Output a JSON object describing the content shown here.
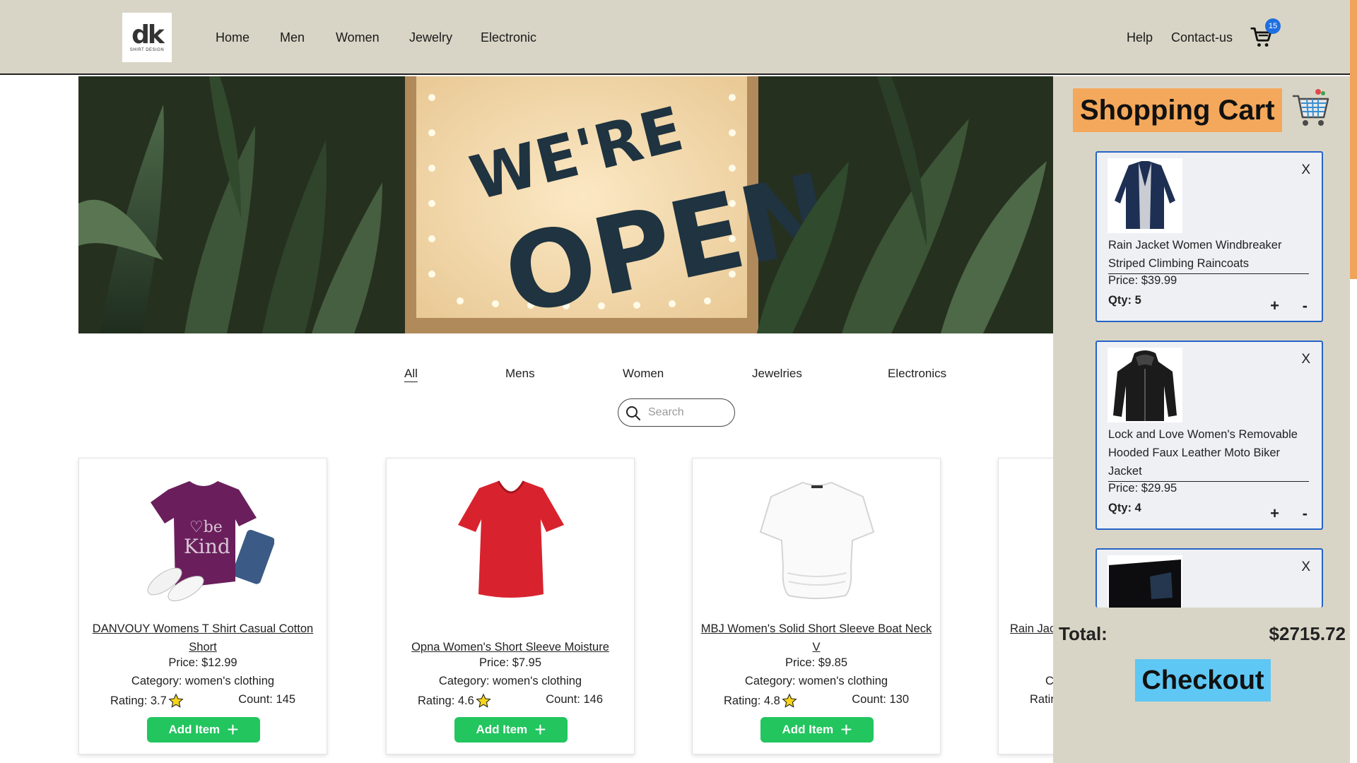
{
  "brand": {
    "logo_text": "dk",
    "logo_sub": "SHIRT DESIGN"
  },
  "nav": {
    "home": "Home",
    "men": "Men",
    "women": "Women",
    "jewelry": "Jewelry",
    "electronic": "Electronic",
    "help": "Help",
    "contact": "Contact-us",
    "cart_count": "15"
  },
  "hero": {
    "sign_line1": "WE'RE",
    "sign_line2": "OPEN"
  },
  "filters": {
    "all": "All",
    "mens": "Mens",
    "women": "Women",
    "jewelries": "Jewelries",
    "electronics": "Electronics"
  },
  "search": {
    "placeholder": "Search"
  },
  "products": [
    {
      "title": "DANVOUY Womens T Shirt Casual Cotton Short",
      "price": "Price: $12.99",
      "category": "Category: women's clothing",
      "rating": "Rating: 3.7",
      "count": "Count: 145",
      "button": "Add Item"
    },
    {
      "title": "Opna Women's Short Sleeve Moisture",
      "price": "Price: $7.95",
      "category": "Category: women's clothing",
      "rating": "Rating: 4.6",
      "count": "Count: 146",
      "button": "Add Item"
    },
    {
      "title": "MBJ Women's Solid Short Sleeve Boat Neck V",
      "price": "Price: $9.85",
      "category": "Category: women's clothing",
      "rating": "Rating: 4.8",
      "count": "Count: 130",
      "button": "Add Item"
    },
    {
      "title": "Rain Jac",
      "price": "",
      "category": "C",
      "rating": "Ratir",
      "count": "",
      "button": ""
    }
  ],
  "cart": {
    "heading": "Shopping Cart",
    "items": [
      {
        "title": "Rain Jacket Women Windbreaker Striped Climbing Raincoats",
        "price": "Price: $39.99",
        "qty": "Qty: 5",
        "close": "X",
        "plus": "+",
        "minus": "-"
      },
      {
        "title": "Lock and Love Women's Removable Hooded Faux Leather Moto Biker Jacket",
        "price": "Price: $29.95",
        "qty": "Qty: 4",
        "close": "X",
        "plus": "+",
        "minus": "-"
      },
      {
        "close": "X"
      }
    ],
    "total_label": "Total:",
    "total_value": "$2715.72",
    "checkout": "Checkout"
  },
  "colors": {
    "topbar": "#d9d5c6",
    "add_button": "#22c55e",
    "cart_heading": "#f4a85b",
    "checkout": "#5fc7f3",
    "cart_border": "#2563c7",
    "badge": "#1f6fe0"
  }
}
